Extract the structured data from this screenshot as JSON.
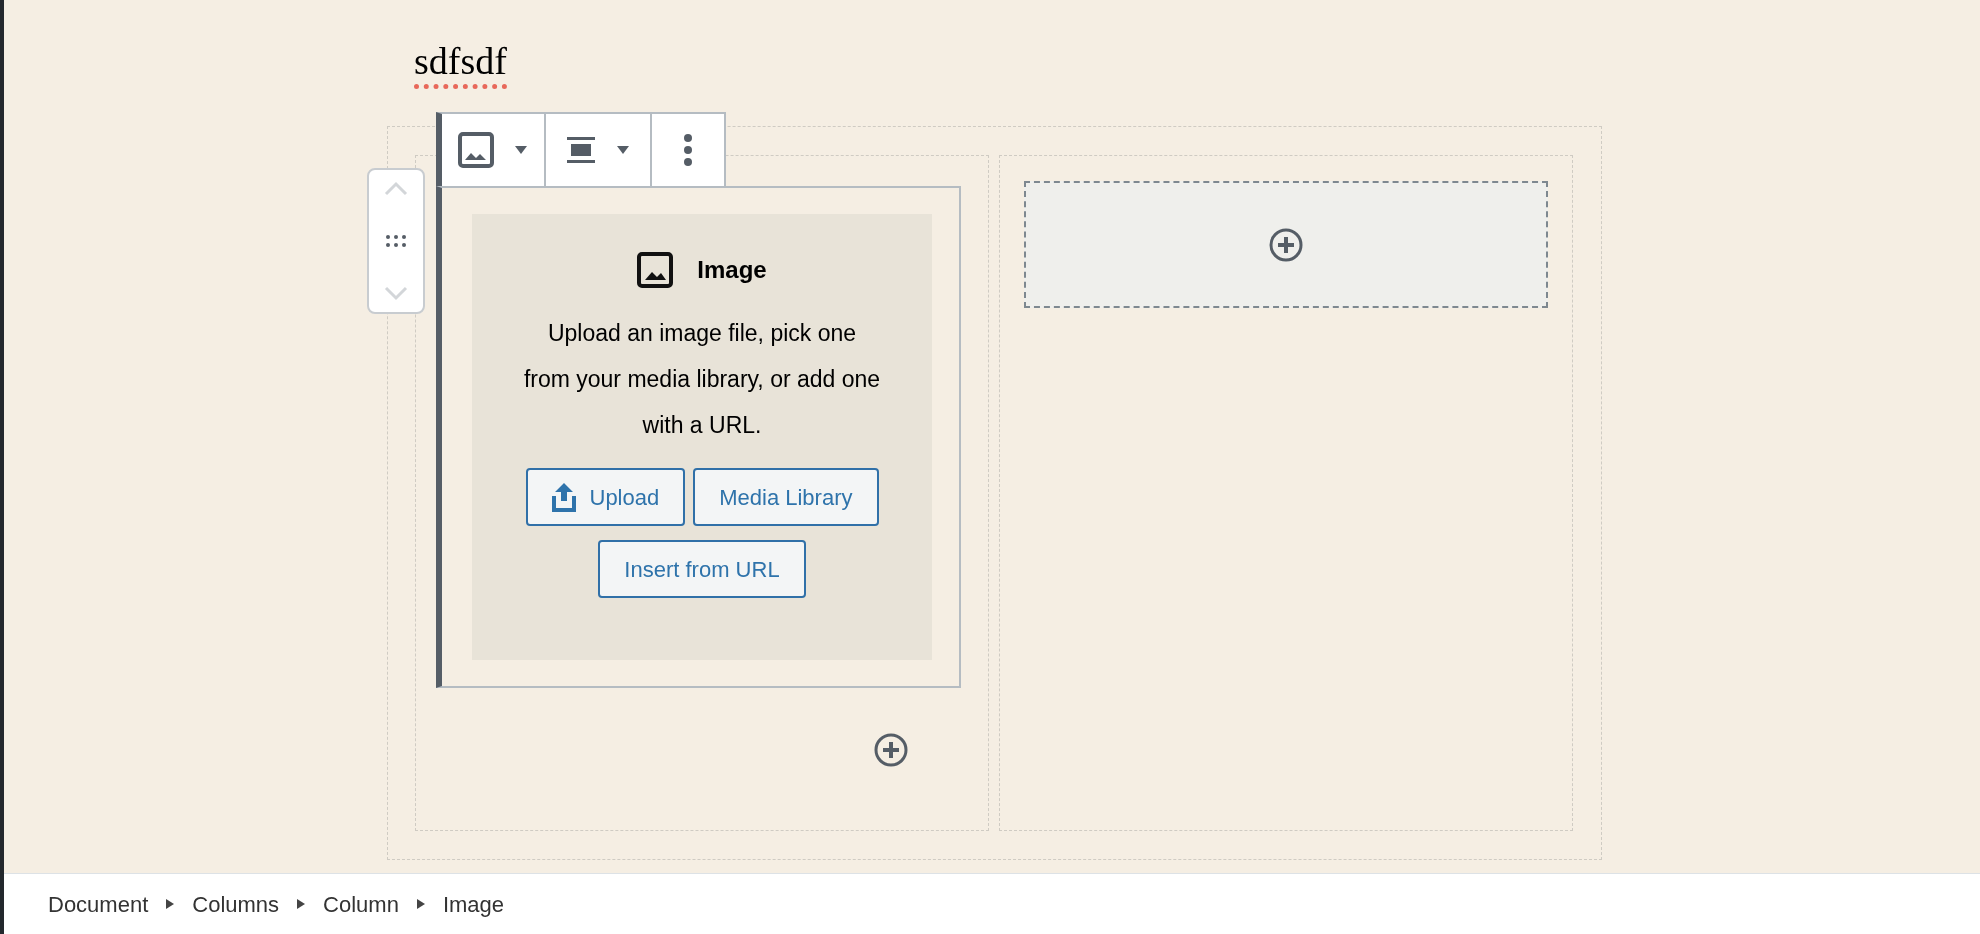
{
  "post_title": {
    "text": "sdfsdf",
    "misspelled": true
  },
  "block_toolbar": [
    {
      "kind": "block-type",
      "has_dropdown": true
    },
    {
      "kind": "alignment",
      "has_dropdown": true
    },
    {
      "kind": "more",
      "has_dropdown": false
    }
  ],
  "image_placeholder": {
    "title": "Image",
    "instructions": "Upload an image file, pick one from your media library, or add one with a URL.",
    "buttons": [
      {
        "label": "Upload",
        "kind": "upload"
      },
      {
        "label": "Media Library",
        "kind": "plain"
      },
      {
        "label": "Insert from URL",
        "kind": "plain"
      }
    ]
  },
  "breadcrumb": [
    "Document",
    "Columns",
    "Column",
    "Image"
  ]
}
